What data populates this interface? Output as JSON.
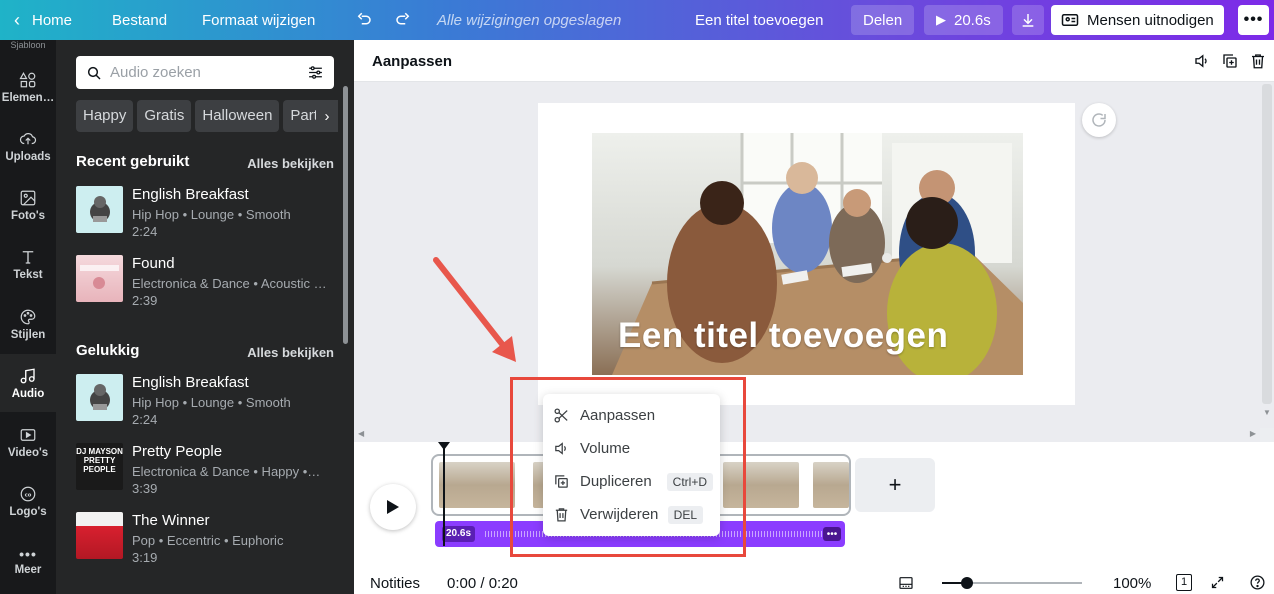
{
  "topbar": {
    "home": "Home",
    "file": "Bestand",
    "resize": "Formaat wijzigen",
    "saved_status": "Alle wijzigingen opgeslagen",
    "doc_title": "Een titel toevoegen",
    "share": "Delen",
    "play_duration": "20.6s",
    "invite": "Mensen uitnodigen"
  },
  "rail": {
    "top_fragment": "Sjabloon",
    "items": [
      {
        "label": "Elemen…",
        "icon": "elements-icon"
      },
      {
        "label": "Uploads",
        "icon": "upload-icon"
      },
      {
        "label": "Foto's",
        "icon": "photo-icon"
      },
      {
        "label": "Tekst",
        "icon": "text-icon"
      },
      {
        "label": "Stijlen",
        "icon": "palette-icon"
      },
      {
        "label": "Audio",
        "icon": "music-icon",
        "active": true
      },
      {
        "label": "Video's",
        "icon": "video-icon"
      },
      {
        "label": "Logo's",
        "icon": "logo-icon"
      },
      {
        "label": "Meer",
        "icon": "more-icon"
      }
    ]
  },
  "panel": {
    "search_placeholder": "Audio zoeken",
    "chips": [
      "Happy",
      "Gratis",
      "Halloween",
      "Party"
    ],
    "recent_title": "Recent gebruikt",
    "happy_title": "Gelukkig",
    "see_all": "Alles bekijken",
    "recent_tracks": [
      {
        "title": "English Breakfast",
        "meta": "Hip Hop • Lounge • Smooth",
        "duration": "2:24"
      },
      {
        "title": "Found",
        "meta": "Electronica & Dance • Acoustic …",
        "duration": "2:39"
      }
    ],
    "happy_tracks": [
      {
        "title": "English Breakfast",
        "meta": "Hip Hop • Lounge • Smooth",
        "duration": "2:24"
      },
      {
        "title": "Pretty People",
        "meta": "Electronica & Dance • Happy •…",
        "duration": "3:39",
        "thumb_text": "DJ MAYSON PRETTY PEOPLE"
      },
      {
        "title": "The Winner",
        "meta": "Pop • Eccentric • Euphoric",
        "duration": "3:19"
      }
    ]
  },
  "editor": {
    "header_title": "Aanpassen",
    "canvas_title": "Een titel toevoegen"
  },
  "timeline": {
    "audio_badge": "20.6s",
    "add": "+"
  },
  "context_menu": {
    "items": [
      {
        "label": "Aanpassen",
        "icon": "scissors-icon",
        "shortcut": ""
      },
      {
        "label": "Volume",
        "icon": "volume-icon",
        "shortcut": ""
      },
      {
        "label": "Dupliceren",
        "icon": "duplicate-icon",
        "shortcut": "Ctrl+D"
      },
      {
        "label": "Verwijderen",
        "icon": "trash-icon",
        "shortcut": "DEL"
      }
    ]
  },
  "bottombar": {
    "notes": "Notities",
    "time": "0:00 / 0:20",
    "zoom": "100%",
    "zoom_level": 0.18,
    "page_count": "1"
  }
}
